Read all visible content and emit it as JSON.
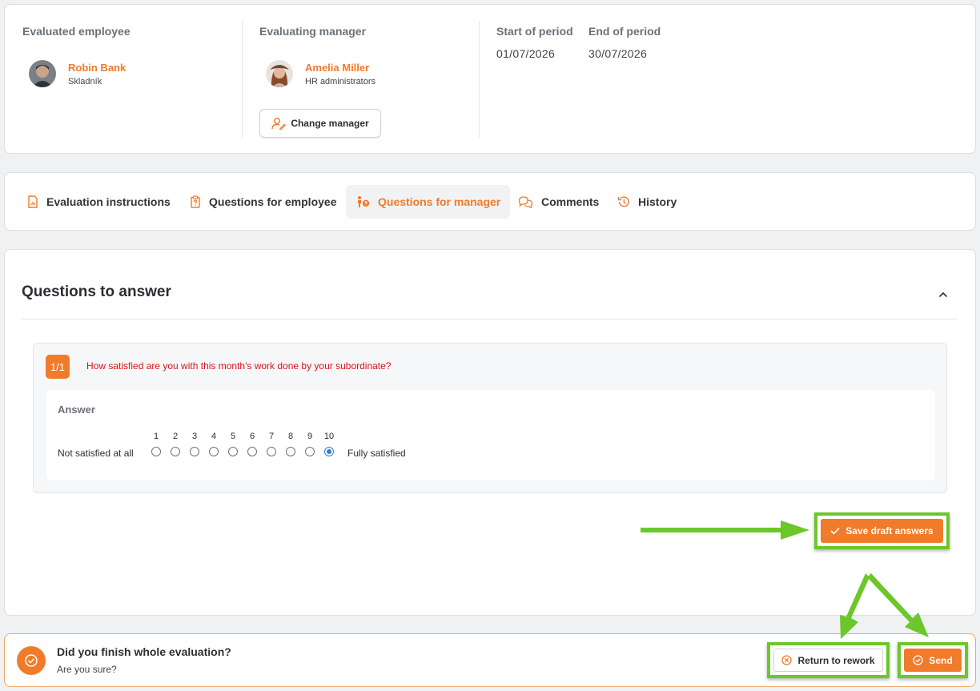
{
  "header": {
    "evaluated_label": "Evaluated employee",
    "employee": {
      "name": "Robin Bank",
      "role": "Skladník"
    },
    "manager_label": "Evaluating manager",
    "manager": {
      "name": "Amelia Miller",
      "role": "HR administrators"
    },
    "change_manager_label": "Change manager",
    "start_label": "Start of period",
    "start_date": "01/07/2026",
    "end_label": "End of period",
    "end_date": "30/07/2026"
  },
  "tabs": [
    {
      "label": "Evaluation instructions",
      "icon": "file-chart-icon",
      "active": false
    },
    {
      "label": "Questions for employee",
      "icon": "clipboard-question-icon",
      "active": false
    },
    {
      "label": "Questions for manager",
      "icon": "person-question-icon",
      "active": true
    },
    {
      "label": "Comments",
      "icon": "chat-bubbles-icon",
      "active": false
    },
    {
      "label": "History",
      "icon": "history-icon",
      "active": false
    }
  ],
  "questions": {
    "title": "Questions to answer",
    "items": [
      {
        "badge": "1/1",
        "text": "How satisfied are you with this month's work done by your subordinate?",
        "answer_label": "Answer",
        "min_label": "Not satisfied at all",
        "max_label": "Fully satisfied",
        "scale": [
          "1",
          "2",
          "3",
          "4",
          "5",
          "6",
          "7",
          "8",
          "9",
          "10"
        ],
        "selected": "10"
      }
    ],
    "save_draft_label": "Save draft answers"
  },
  "bottom": {
    "title": "Did you finish whole evaluation?",
    "subtitle": "Are you sure?",
    "return_label": "Return to rework",
    "send_label": "Send"
  },
  "colors": {
    "accent": "#f07b2a",
    "highlight": "#6cc72a",
    "question_text": "#d6161c",
    "radio_selected": "#2a7de1"
  }
}
